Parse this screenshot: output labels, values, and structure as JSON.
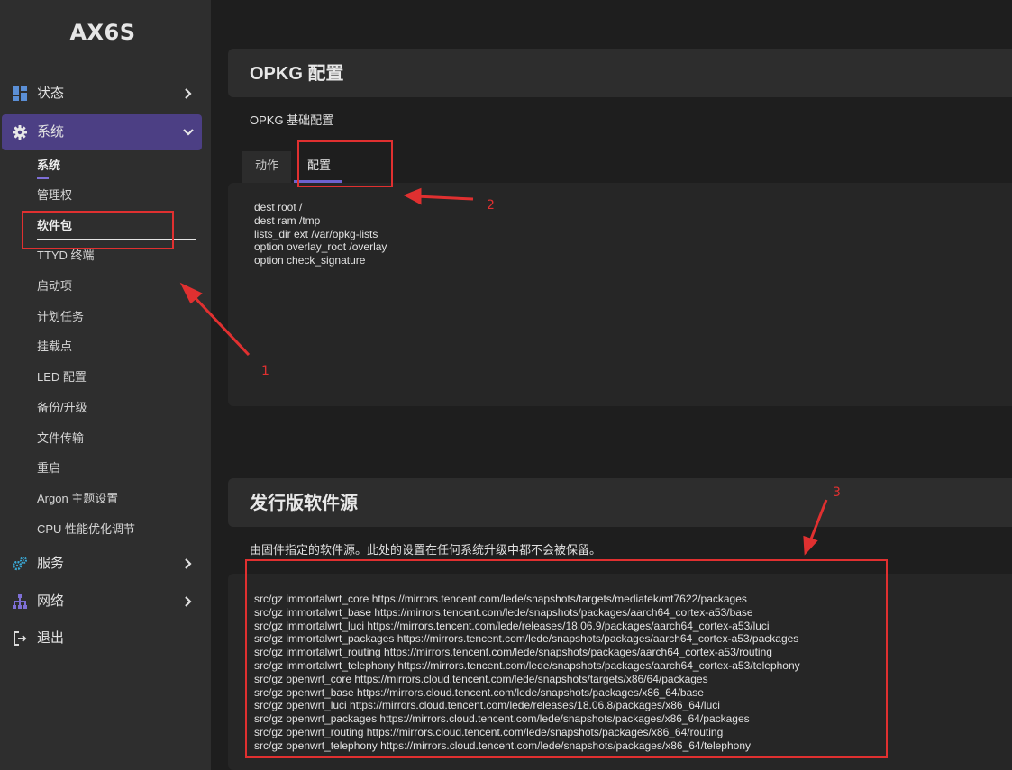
{
  "brand": "AX6S",
  "sidebar": {
    "top_items": [
      {
        "label": "状态",
        "icon": "dashboard-icon"
      },
      {
        "label": "系统",
        "icon": "gear-icon"
      },
      {
        "label": "服务",
        "icon": "cogs-icon"
      },
      {
        "label": "网络",
        "icon": "network-icon"
      },
      {
        "label": "退出",
        "icon": "logout-icon"
      }
    ],
    "system_subitems": [
      "系统",
      "管理权",
      "软件包",
      "TTYD 终端",
      "启动项",
      "计划任务",
      "挂载点",
      "LED 配置",
      "备份/升级",
      "文件传输",
      "重启",
      "Argon 主题设置",
      "CPU 性能优化调节"
    ]
  },
  "opkg": {
    "title": "OPKG 配置",
    "description": "OPKG 基础配置",
    "tabs": [
      "动作",
      "配置"
    ],
    "active_tab": "配置",
    "config_lines": [
      "dest root /",
      "dest ram /tmp",
      "lists_dir ext /var/opkg-lists",
      "option overlay_root /overlay",
      "option check_signature"
    ]
  },
  "distfeeds": {
    "title": "发行版软件源",
    "description": "由固件指定的软件源。此处的设置在任何系统升级中都不会被保留。",
    "lines": [
      "src/gz immortalwrt_core https://mirrors.tencent.com/lede/snapshots/targets/mediatek/mt7622/packages",
      "src/gz immortalwrt_base https://mirrors.tencent.com/lede/snapshots/packages/aarch64_cortex-a53/base",
      "src/gz immortalwrt_luci https://mirrors.tencent.com/lede/releases/18.06.9/packages/aarch64_cortex-a53/luci",
      "src/gz immortalwrt_packages https://mirrors.tencent.com/lede/snapshots/packages/aarch64_cortex-a53/packages",
      "src/gz immortalwrt_routing https://mirrors.tencent.com/lede/snapshots/packages/aarch64_cortex-a53/routing",
      "src/gz immortalwrt_telephony https://mirrors.tencent.com/lede/snapshots/packages/aarch64_cortex-a53/telephony",
      "src/gz openwrt_core https://mirrors.cloud.tencent.com/lede/snapshots/targets/x86/64/packages",
      "src/gz openwrt_base https://mirrors.cloud.tencent.com/lede/snapshots/packages/x86_64/base",
      "src/gz openwrt_luci https://mirrors.cloud.tencent.com/lede/releases/18.06.8/packages/x86_64/luci",
      "src/gz openwrt_packages https://mirrors.cloud.tencent.com/lede/snapshots/packages/x86_64/packages",
      "src/gz openwrt_routing https://mirrors.cloud.tencent.com/lede/snapshots/packages/x86_64/routing",
      "src/gz openwrt_telephony https://mirrors.cloud.tencent.com/lede/snapshots/packages/x86_64/telephony"
    ]
  },
  "annotations": [
    "1",
    "2",
    "3"
  ],
  "colors": {
    "accent": "#4c3f84",
    "tab_underline": "#6d62ce",
    "annotation": "#e03030"
  }
}
